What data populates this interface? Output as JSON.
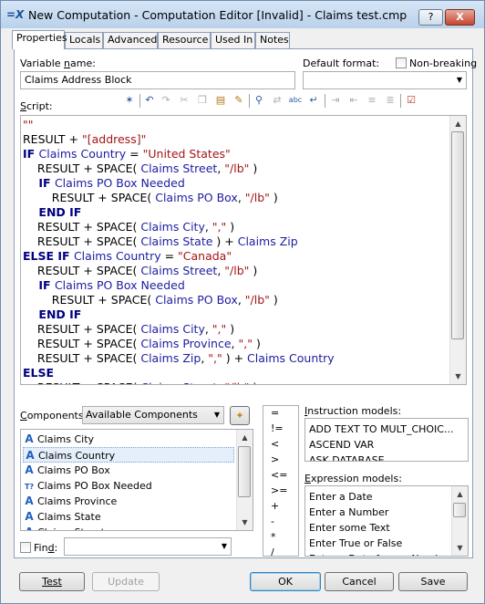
{
  "window": {
    "icon_text": "=X",
    "title": "New Computation - Computation Editor [Invalid] - Claims test.cmp",
    "help_label": "?",
    "close_label": "X"
  },
  "tabs": [
    "Properties",
    "Locals",
    "Advanced",
    "Resource",
    "Used In",
    "Notes"
  ],
  "properties": {
    "variable_name_label_a": "Variable ",
    "variable_name_label_u": "n",
    "variable_name_label_b": "ame:",
    "variable_name_value": "Claims Address Block",
    "default_format_label": "Default format:",
    "default_format_value": "",
    "non_breaking_label": "Non-breaking",
    "script_label_u": "S",
    "script_label_rest": "cript:"
  },
  "toolbar_icons": [
    "wand-icon",
    "undo-icon",
    "redo-icon",
    "cut-icon",
    "copy-icon",
    "paste-icon",
    "paste-special-icon",
    "find-icon",
    "replace-icon",
    "spell-check-icon",
    "wrap-icon",
    "indent-icon",
    "outdent-icon",
    "comment-icon",
    "uncomment-icon",
    "verify-icon"
  ],
  "script_lines": [
    [
      [
        "str",
        "\"\""
      ]
    ],
    [
      [
        "txt",
        "RESULT + "
      ],
      [
        "str",
        "\"[address]\""
      ]
    ],
    [
      [
        "kw",
        "IF "
      ],
      [
        "var",
        "Claims Country"
      ],
      [
        "txt",
        " = "
      ],
      [
        "str",
        "\"United States\""
      ]
    ],
    [
      [
        "txt",
        "    RESULT + SPACE( "
      ],
      [
        "var",
        "Claims Street"
      ],
      [
        "txt",
        ", "
      ],
      [
        "str",
        "\"/lb\""
      ],
      [
        "txt",
        " )"
      ]
    ],
    [
      [
        "kw",
        "    IF "
      ],
      [
        "var",
        "Claims PO Box Needed"
      ]
    ],
    [
      [
        "txt",
        "        RESULT + SPACE( "
      ],
      [
        "var",
        "Claims PO Box"
      ],
      [
        "txt",
        ", "
      ],
      [
        "str",
        "\"/lb\""
      ],
      [
        "txt",
        " )"
      ]
    ],
    [
      [
        "kw",
        "    END IF"
      ]
    ],
    [
      [
        "txt",
        "    RESULT + SPACE( "
      ],
      [
        "var",
        "Claims City"
      ],
      [
        "txt",
        ", "
      ],
      [
        "str",
        "\",\""
      ],
      [
        "txt",
        " )"
      ]
    ],
    [
      [
        "txt",
        "    RESULT + SPACE( "
      ],
      [
        "var",
        "Claims State"
      ],
      [
        "txt",
        " ) + "
      ],
      [
        "var",
        "Claims Zip"
      ]
    ],
    [
      [
        "kw",
        "ELSE IF "
      ],
      [
        "var",
        "Claims Country"
      ],
      [
        "txt",
        " = "
      ],
      [
        "str",
        "\"Canada\""
      ]
    ],
    [
      [
        "txt",
        "    RESULT + SPACE( "
      ],
      [
        "var",
        "Claims Street"
      ],
      [
        "txt",
        ", "
      ],
      [
        "str",
        "\"/lb\""
      ],
      [
        "txt",
        " )"
      ]
    ],
    [
      [
        "kw",
        "    IF "
      ],
      [
        "var",
        "Claims PO Box Needed"
      ]
    ],
    [
      [
        "txt",
        "        RESULT + SPACE( "
      ],
      [
        "var",
        "Claims PO Box"
      ],
      [
        "txt",
        ", "
      ],
      [
        "str",
        "\"/lb\""
      ],
      [
        "txt",
        " )"
      ]
    ],
    [
      [
        "kw",
        "    END IF"
      ]
    ],
    [
      [
        "txt",
        "    RESULT + SPACE( "
      ],
      [
        "var",
        "Claims City"
      ],
      [
        "txt",
        ", "
      ],
      [
        "str",
        "\",\""
      ],
      [
        "txt",
        " )"
      ]
    ],
    [
      [
        "txt",
        "    RESULT + SPACE( "
      ],
      [
        "var",
        "Claims Province"
      ],
      [
        "txt",
        ", "
      ],
      [
        "str",
        "\",\""
      ],
      [
        "txt",
        " )"
      ]
    ],
    [
      [
        "txt",
        "    RESULT + SPACE( "
      ],
      [
        "var",
        "Claims Zip"
      ],
      [
        "txt",
        ", "
      ],
      [
        "str",
        "\",\""
      ],
      [
        "txt",
        " ) + "
      ],
      [
        "var",
        "Claims Country"
      ]
    ],
    [
      [
        "kw",
        "ELSE"
      ]
    ],
    [
      [
        "txt",
        "    RESULT + SPACE( "
      ],
      [
        "var",
        "Claims Street"
      ],
      [
        "txt",
        ", "
      ],
      [
        "str",
        "\"/lb\""
      ],
      [
        "txt",
        " )"
      ]
    ]
  ],
  "components": {
    "label_u": "C",
    "label_rest": "omponents:",
    "source": "Available Components",
    "items": [
      {
        "icon": "A",
        "label": "Claims City"
      },
      {
        "icon": "A",
        "label": "Claims Country",
        "selected": true
      },
      {
        "icon": "A",
        "label": "Claims PO Box"
      },
      {
        "icon": "T?",
        "label": "Claims PO Box Needed"
      },
      {
        "icon": "A",
        "label": "Claims Province"
      },
      {
        "icon": "A",
        "label": "Claims State"
      },
      {
        "icon": "A",
        "label": "Claims Street"
      }
    ],
    "find_label_a": "Fin",
    "find_label_u": "d",
    "find_label_b": ":",
    "find_value": ""
  },
  "operators": [
    "=",
    "!=",
    "<",
    ">",
    "<=",
    ">=",
    "+",
    "-",
    "*",
    "/"
  ],
  "instruction_models": {
    "label_a": "I",
    "label_rest": "nstruction models:",
    "items": [
      "ADD TEXT TO MULT_CHOIC...",
      "ASCEND VAR",
      "ASK DATABASE"
    ]
  },
  "expression_models": {
    "label_a": "E",
    "label_rest": "xpression models:",
    "items": [
      "Enter a Date",
      "Enter a Number",
      "Enter some Text",
      "Enter True or False",
      "Enter a Date from a Number"
    ]
  },
  "buttons": {
    "test": "Test",
    "update": "Update",
    "ok": "OK",
    "cancel": "Cancel",
    "save": "Save"
  }
}
